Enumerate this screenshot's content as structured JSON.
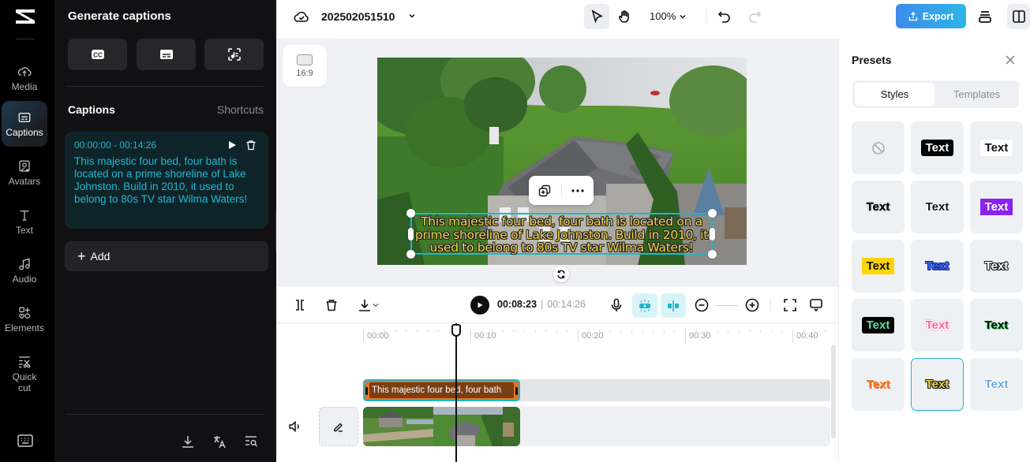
{
  "rail": {
    "items": [
      {
        "id": "media",
        "label": "Media",
        "icon": "cloud-upload-icon"
      },
      {
        "id": "captions",
        "label": "Captions",
        "icon": "captions-icon",
        "active": true
      },
      {
        "id": "avatars",
        "label": "Avatars",
        "icon": "avatar-icon"
      },
      {
        "id": "text",
        "label": "Text",
        "icon": "text-icon"
      },
      {
        "id": "audio",
        "label": "Audio",
        "icon": "music-note-icon"
      },
      {
        "id": "elements",
        "label": "Elements",
        "icon": "elements-icon"
      },
      {
        "id": "quick-cut",
        "label": "Quick cut",
        "icon": "quick-cut-icon"
      }
    ]
  },
  "panel": {
    "title": "Generate captions",
    "generate_buttons": [
      "auto-captions",
      "manual-captions",
      "lyrics-captions"
    ],
    "section_title": "Captions",
    "shortcuts_label": "Shortcuts",
    "caption": {
      "time_range": "00:00:00 - 00:14:26",
      "text": "This majestic four bed, four bath is located on a prime shoreline of Lake Johnston. Build in 2010, it used to belong to 80s TV star Wilma Waters!"
    },
    "add_label": "Add"
  },
  "topbar": {
    "project_name": "202502051510",
    "zoom_level": "100%",
    "export_label": "Export"
  },
  "canvas": {
    "aspect_ratio": "16:9",
    "caption_overlay": "This majestic four bed, four bath is located on a prime shoreline of Lake Johnston. Build in 2010, it used to belong to 80s TV star Wilma Waters!",
    "caption_color": "#f4d24c"
  },
  "presets": {
    "title": "Presets",
    "tabs": [
      {
        "label": "Styles",
        "active": true
      },
      {
        "label": "Templates",
        "active": false
      }
    ],
    "sample_text": "Text",
    "selected_index": 13
  },
  "timeline": {
    "current_time": "00:08:23",
    "total_time": "00:14:26",
    "ruler_labels": [
      "00:00",
      "00:10",
      "00:20",
      "00:30",
      "00:40"
    ],
    "caption_clip_text": "This majestic four bed, four bath",
    "accent": "#1bb8c9",
    "caption_clip_color": "#e57324"
  }
}
